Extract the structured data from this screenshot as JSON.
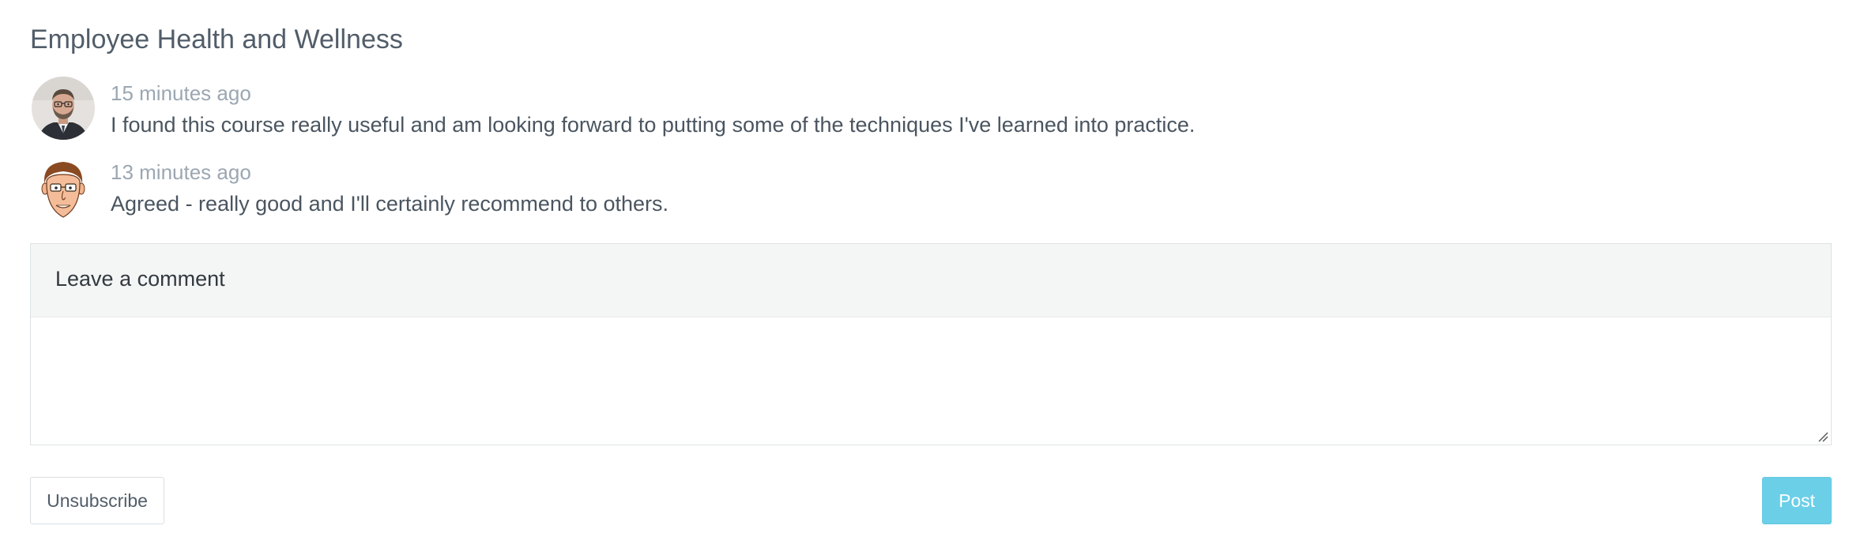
{
  "page": {
    "title": "Employee Health and Wellness"
  },
  "comments": [
    {
      "time": "15 minutes ago",
      "text": "I found this course really useful and am looking forward to putting some of the techniques I've learned into practice.",
      "avatar_icon": "user-photo-avatar"
    },
    {
      "time": "13 minutes ago",
      "text": "Agreed - really good and I'll certainly recommend to others.",
      "avatar_icon": "cartoon-face-avatar"
    }
  ],
  "comment_form": {
    "header": "Leave a comment",
    "value": "",
    "placeholder": ""
  },
  "actions": {
    "unsubscribe_label": "Unsubscribe",
    "post_label": "Post"
  },
  "colors": {
    "post_button": "#6bcfe8",
    "form_header_bg": "#f4f6f5",
    "muted_text": "#9ba7b2"
  }
}
